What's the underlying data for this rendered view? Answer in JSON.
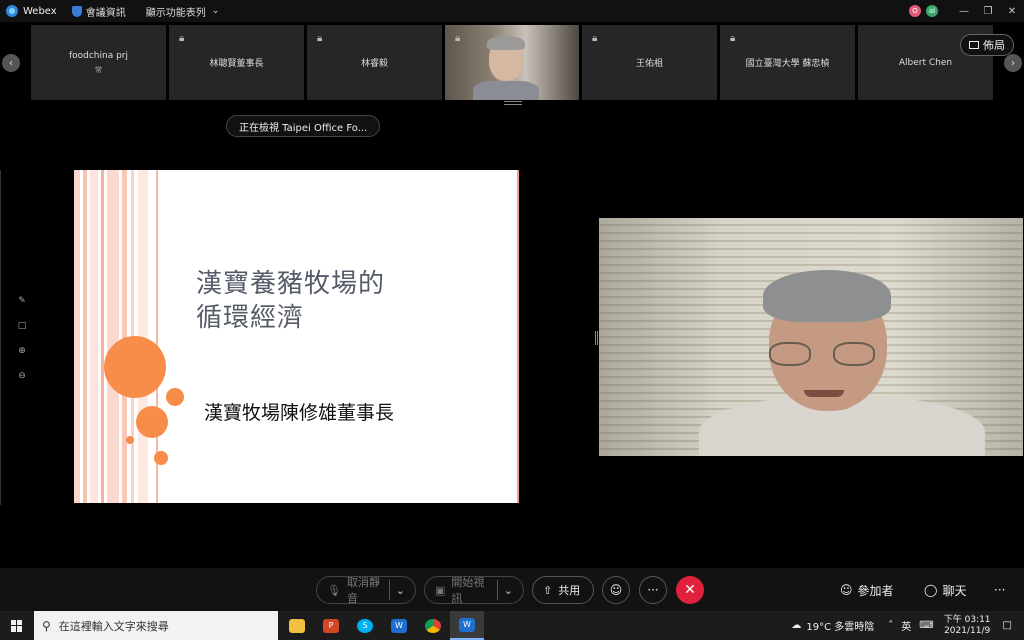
{
  "titlebar": {
    "app_name": "Webex",
    "meeting_info": "會議資訊",
    "show_menu": "顯示功能表列",
    "presence_initial_1": "O",
    "presence_initial_2": "al"
  },
  "participants": [
    {
      "name": "foodchina prj",
      "sub": "常",
      "locked": false
    },
    {
      "name": "林聰賢董事長",
      "locked": true
    },
    {
      "name": "林睿毅",
      "locked": true
    },
    {
      "name": "",
      "locked": true,
      "video": true
    },
    {
      "name": "王佑柤",
      "locked": true
    },
    {
      "name": "國立臺灣大學 蘇忠楨",
      "locked": true
    },
    {
      "name": "Albert Chen",
      "locked": false
    }
  ],
  "layout_button": "佈局",
  "viewing": "正在檢視 Taipei Office Fo...",
  "slide": {
    "title_line1": "漢寶養豬牧場的",
    "title_line2": "循環經濟",
    "subtitle": "漢寶牧場陳修雄董事長"
  },
  "controls": {
    "unmute": "取消靜音",
    "start_video": "開始視訊",
    "share": "共用",
    "participants": "參加者",
    "chat": "聊天"
  },
  "taskbar": {
    "search_placeholder": "在這裡輸入文字來搜尋",
    "weather": "19°C 多雲時陰",
    "ime": "英",
    "time": "下午 03:11",
    "date": "2021/11/9"
  },
  "colors": {
    "end_call": "#e0213b",
    "slide_accent": "#f78d48",
    "slide_title": "#555b68"
  }
}
